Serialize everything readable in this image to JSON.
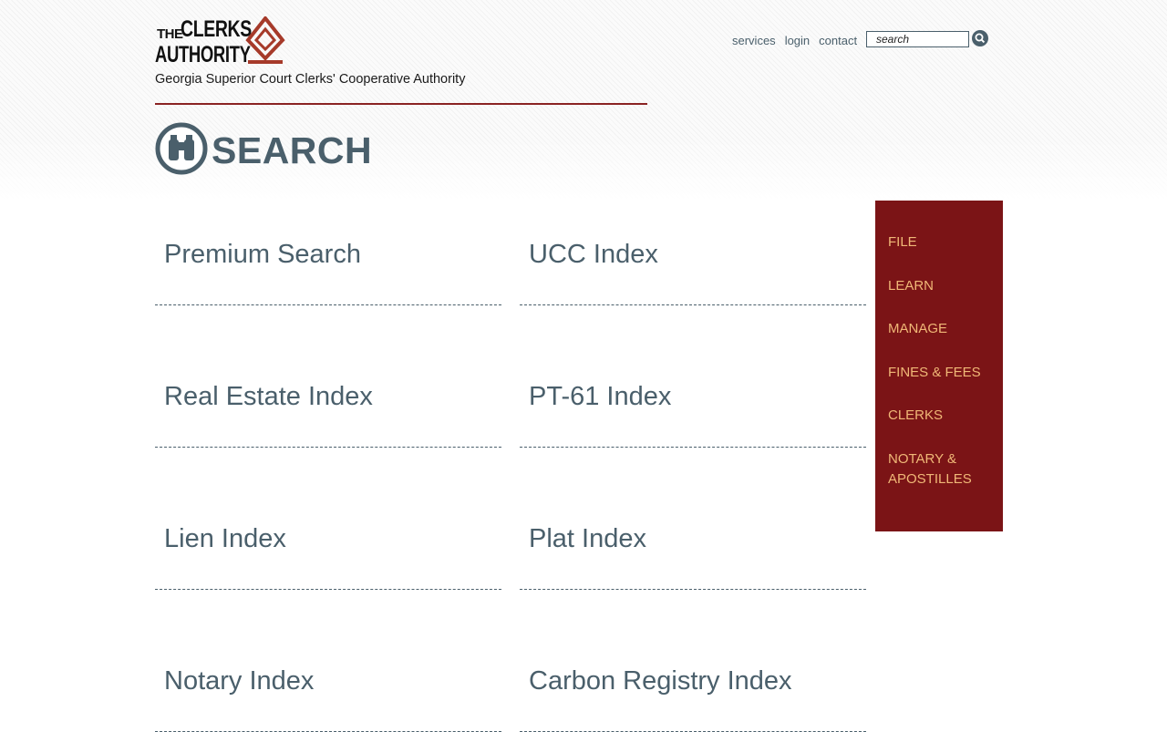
{
  "brand": {
    "logo_the": "THE",
    "logo_clerks": "CLERKS",
    "logo_authority": "AUTHORITY",
    "tagline": "Georgia Superior Court Clerks' Cooperative Authority",
    "accent_color": "#8a2323"
  },
  "topnav": {
    "items": [
      "services",
      "login",
      "contact"
    ],
    "search_placeholder": "search"
  },
  "page": {
    "title": "SEARCH",
    "icon": "binoculars-icon"
  },
  "cards": [
    {
      "label": "Premium Search"
    },
    {
      "label": "UCC Index"
    },
    {
      "label": "Real Estate Index"
    },
    {
      "label": "PT-61 Index"
    },
    {
      "label": "Lien Index"
    },
    {
      "label": "Plat Index"
    },
    {
      "label": "Notary Index"
    },
    {
      "label": "Carbon Registry Index"
    }
  ],
  "sidebar": {
    "background": "#7b1416",
    "text_color": "#f0b877",
    "items": [
      {
        "label": "FILE"
      },
      {
        "label": "LEARN"
      },
      {
        "label": "MANAGE"
      },
      {
        "label": "FINES & FEES"
      },
      {
        "label": "CLERKS"
      },
      {
        "label": "NOTARY & APOSTILLES"
      }
    ]
  }
}
